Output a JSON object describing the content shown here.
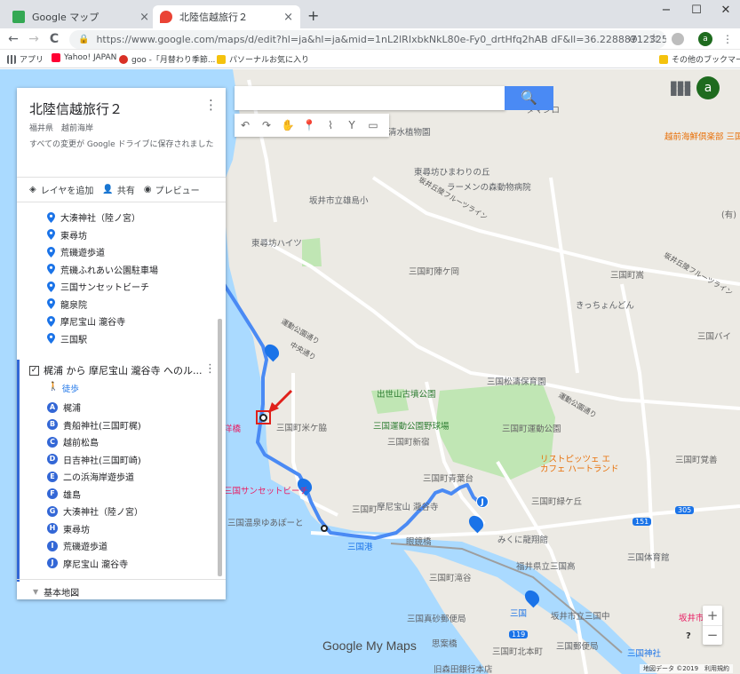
{
  "browser": {
    "tabs": [
      {
        "title": "Google マップ",
        "close": "×",
        "color": "#34a853"
      },
      {
        "title": "北陸信越旅行２",
        "close": "×",
        "color": "#ea4335"
      }
    ],
    "new_tab": "+",
    "window": {
      "minimize": "−",
      "maximize": "☐",
      "close": "✕"
    },
    "nav": {
      "back": "←",
      "forward": "→",
      "reload": "C"
    },
    "url": "https://www.google.com/maps/d/edit?hl=ja&hl=ja&mid=1nL2lRIxbkNkL80e-Fy0_drtHfq2hAB dF&ll=36.22888712325705%2C136.13952446...",
    "omni_icons": {
      "zoom": "⊕",
      "star": "☆"
    },
    "profile": "a",
    "menu": "⋮",
    "bookmarks": [
      {
        "label": "アプリ",
        "color": "#5f6368"
      },
      {
        "label": "Yahoo! JAPAN",
        "color": "#ff0033"
      },
      {
        "label": "goo -「月替わり季節...",
        "color": "#d93025"
      },
      {
        "label": "パソーナルお気に入り",
        "color": "#f4c20d"
      }
    ],
    "other_bookmarks": "その他のブックマーク"
  },
  "panel": {
    "title": "北陸信越旅行２",
    "subtitle": "福井県　越前海岸",
    "save_status": "すべての変更が Google ドライブに保存されました",
    "menu": "⋮",
    "actions": {
      "add_layer": "レイヤを追加",
      "share": "共有",
      "preview": "プレビュー"
    },
    "places": [
      "大湊神社（陸ノ宮）",
      "東尋坊",
      "荒磯遊歩道",
      "荒磯ふれあい公園駐車場",
      "三国サンセットビーチ",
      "龍泉院",
      "摩尼宝山 瀧谷寺",
      "三国駅"
    ],
    "route_layer": {
      "title": "梶浦 から 摩尼宝山 瀧谷寺 へのル...",
      "mode": "徒歩",
      "stops": [
        {
          "letter": "A",
          "name": "梶浦"
        },
        {
          "letter": "B",
          "name": "貴船神社(三国町梶)"
        },
        {
          "letter": "C",
          "name": "越前松島"
        },
        {
          "letter": "D",
          "name": "日吉神社(三国町崎)"
        },
        {
          "letter": "E",
          "name": "二の浜海岸遊歩道"
        },
        {
          "letter": "F",
          "name": "雄島"
        },
        {
          "letter": "G",
          "name": "大湊神社（陸ノ宮）"
        },
        {
          "letter": "H",
          "name": "東尋坊"
        },
        {
          "letter": "I",
          "name": "荒磯遊歩道"
        },
        {
          "letter": "J",
          "name": "摩尼宝山 瀧谷寺"
        }
      ]
    },
    "base_map": "基本地図"
  },
  "map": {
    "search_icon": "🔍",
    "tools": [
      "↶",
      "↷",
      "✋",
      "📍",
      "⌇",
      "Y",
      "▭"
    ],
    "apps_icon": "⋮⋮⋮",
    "avatar": "a",
    "zoom_in": "+",
    "zoom_out": "−",
    "help": "?",
    "footer": "地図データ ©2019　利用規約",
    "watermark": "Google My Maps",
    "labels": [
      {
        "text": "清水植物園",
        "cls": "poi"
      },
      {
        "text": "東尋坊ひまわりの丘",
        "cls": "poi"
      },
      {
        "text": "ラーメンの森動物病院",
        "cls": "poi"
      },
      {
        "text": "坂井丘陵フルーツライン",
        "cls": "road"
      },
      {
        "text": "坂井市立雄島小",
        "cls": "poi"
      },
      {
        "text": "東尋坊ハイツ",
        "cls": "poi"
      },
      {
        "text": "三国町陣ケ岡",
        "cls": "area"
      },
      {
        "text": "三国町嵩",
        "cls": "area"
      },
      {
        "text": "坂井丘陵フルーツライン",
        "cls": "road"
      },
      {
        "text": "きっちょんどん",
        "cls": "poi"
      },
      {
        "text": "三国バイ",
        "cls": "area"
      },
      {
        "text": "運動公園通り",
        "cls": "road"
      },
      {
        "text": "中央通り",
        "cls": "road"
      },
      {
        "text": "三国松濤保育園",
        "cls": "poi"
      },
      {
        "text": "出世山古墳公園",
        "cls": "park"
      },
      {
        "text": "三国運動公園野球場",
        "cls": "park"
      },
      {
        "text": "三国町新宿",
        "cls": "area"
      },
      {
        "text": "三国町運動公園",
        "cls": "area"
      },
      {
        "text": "運動公園通り",
        "cls": "road"
      },
      {
        "text": "リストピッツェ エ カフェ ハートランド",
        "cls": "orange"
      },
      {
        "text": "三国町米ケ脇",
        "cls": "area"
      },
      {
        "text": "三国サンセットビーチ",
        "cls": "pink"
      },
      {
        "text": "三国町青葉台",
        "cls": "area"
      },
      {
        "text": "三国町緑ケ丘",
        "cls": "area"
      },
      {
        "text": "三国町覚善",
        "cls": "area"
      },
      {
        "text": "摩尼宝山 瀧谷寺",
        "cls": "poi"
      },
      {
        "text": "三国町",
        "cls": "area"
      },
      {
        "text": "三国温泉ゆあぽーと",
        "cls": "poi"
      },
      {
        "text": "三国港",
        "cls": "station"
      },
      {
        "text": "眼鏡橋",
        "cls": "poi"
      },
      {
        "text": "みくに龍翔館",
        "cls": "poi"
      },
      {
        "text": "福井県立三国高",
        "cls": "poi"
      },
      {
        "text": "三国体育館",
        "cls": "poi"
      },
      {
        "text": "三国町滝谷",
        "cls": "area"
      },
      {
        "text": "三国",
        "cls": "station"
      },
      {
        "text": "坂井市立三国中",
        "cls": "poi"
      },
      {
        "text": "坂井市役所",
        "cls": "pink"
      },
      {
        "text": "三国真砂郵便局",
        "cls": "poi"
      },
      {
        "text": "思案橋",
        "cls": "poi"
      },
      {
        "text": "三国町北本町",
        "cls": "area"
      },
      {
        "text": "三国郵便局",
        "cls": "poi"
      },
      {
        "text": "三国神社",
        "cls": "station"
      },
      {
        "text": "旧森田銀行本店",
        "cls": "poi"
      },
      {
        "text": "越前海鮮倶楽部 三国本店",
        "cls": "orange"
      },
      {
        "text": "(有)",
        "cls": "area"
      },
      {
        "text": "タマシロ",
        "cls": "area"
      },
      {
        "text": "洋橋",
        "cls": "pink"
      }
    ],
    "roads": [
      "305",
      "151",
      "119"
    ],
    "colors": {
      "route": "#4a8af4",
      "water": "#aadaff",
      "park": "#c0e6b4",
      "pin": "#1a73e8",
      "highlight": "#e0201a"
    }
  }
}
